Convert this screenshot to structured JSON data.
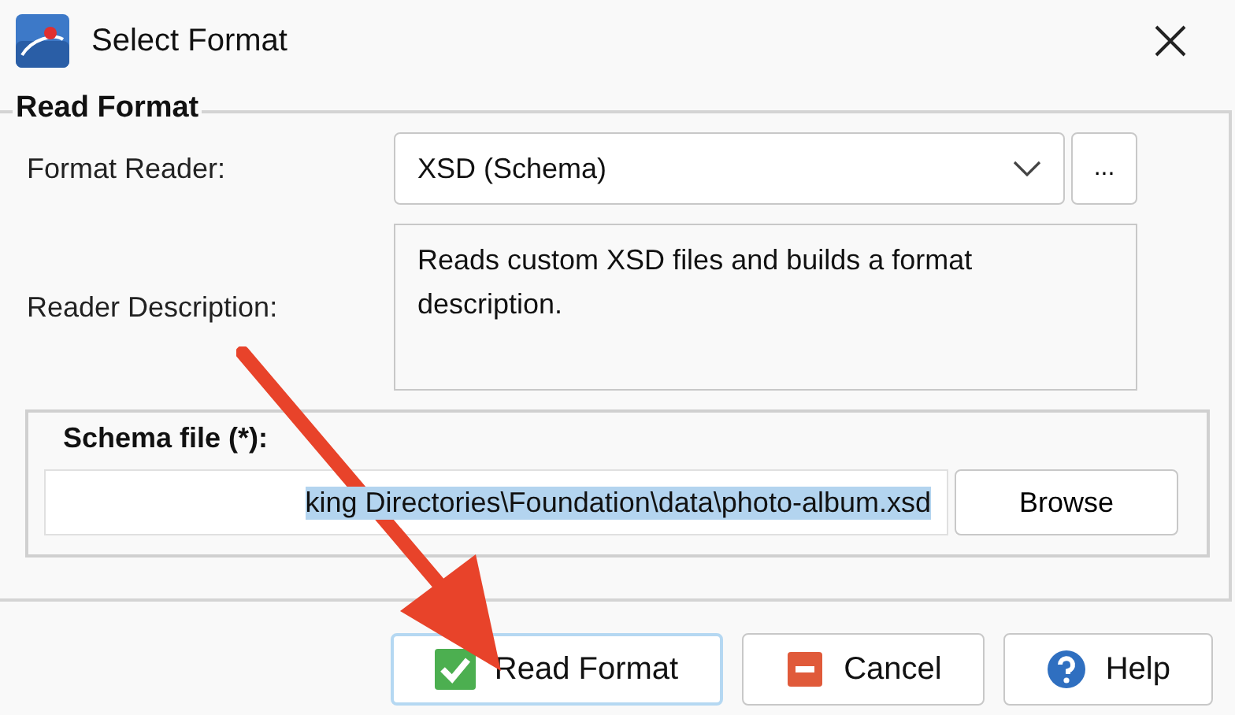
{
  "window": {
    "title": "Select Format"
  },
  "group": {
    "legend": "Read Format",
    "format_reader": {
      "label": "Format Reader:",
      "value": "XSD (Schema)",
      "more_button": "..."
    },
    "reader_description": {
      "label": "Reader Description:",
      "text": "Reads custom XSD files and builds a format description."
    },
    "schema_file": {
      "legend": "Schema file (*):",
      "value": "king Directories\\Foundation\\data\\photo-album.xsd",
      "selected": true,
      "browse_button": "Browse"
    }
  },
  "buttons": [
    {
      "label": "Read Format",
      "kind": "ok",
      "focused": true
    },
    {
      "label": "Cancel",
      "kind": "cancel",
      "focused": false
    },
    {
      "label": "Help",
      "kind": "help",
      "focused": false
    }
  ]
}
